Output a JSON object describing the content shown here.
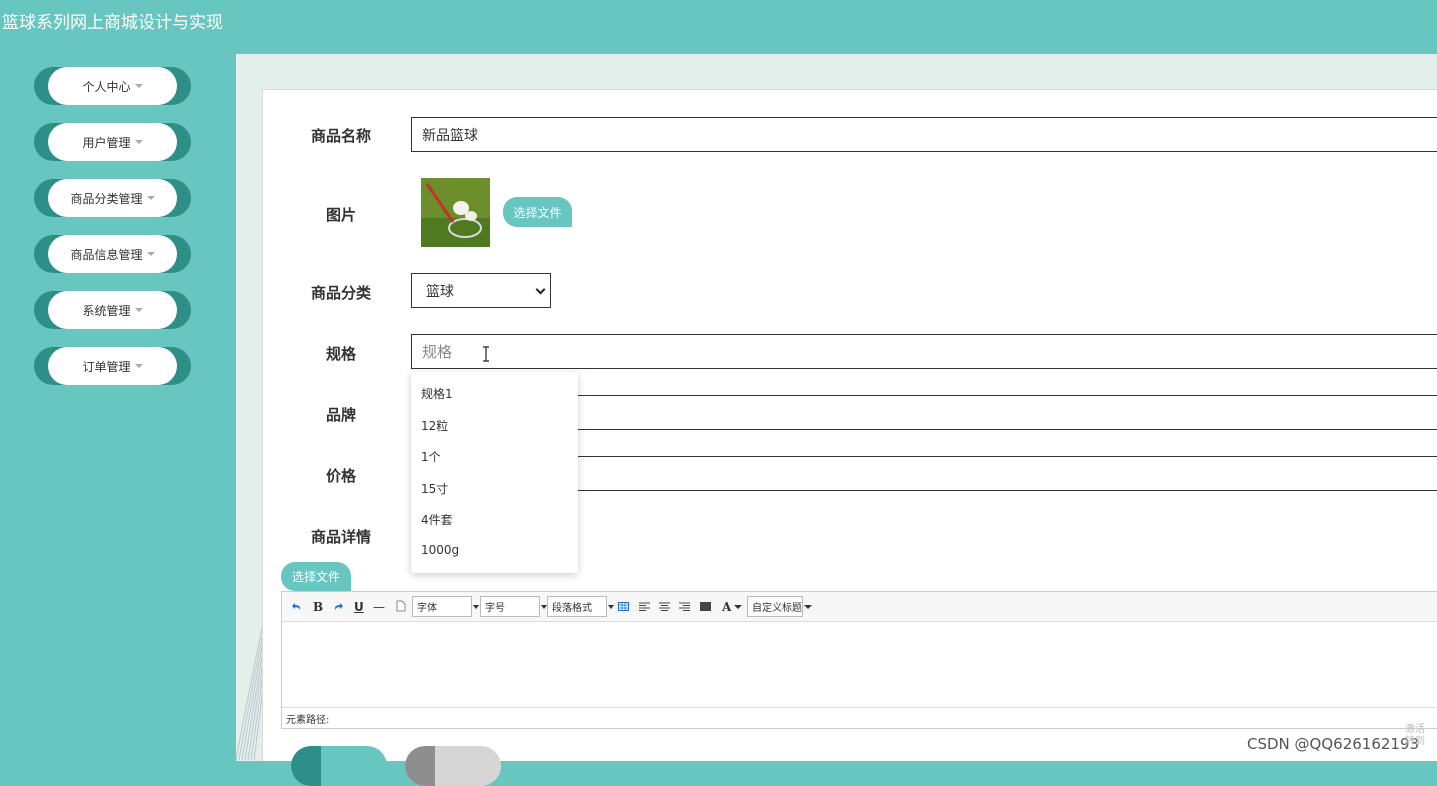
{
  "app": {
    "title": "篮球系列网上商城设计与实现"
  },
  "sidebar": {
    "items": [
      {
        "label": "个人中心"
      },
      {
        "label": "用户管理"
      },
      {
        "label": "商品分类管理"
      },
      {
        "label": "商品信息管理"
      },
      {
        "label": "系统管理"
      },
      {
        "label": "订单管理"
      }
    ]
  },
  "form": {
    "name_label": "商品名称",
    "name_value": "新品篮球",
    "image_label": "图片",
    "choose_file": "选择文件",
    "category_label": "商品分类",
    "category_value": "篮球",
    "spec_label": "规格",
    "spec_placeholder": "规格",
    "brand_label": "品牌",
    "price_label": "价格",
    "detail_label": "商品详情",
    "spec_suggestions": [
      "规格1",
      "12粒",
      "1个",
      "15寸",
      "4件套",
      "1000g"
    ]
  },
  "editor": {
    "choose_file": "选择文件",
    "toolbar": {
      "bold": "B",
      "underline": "U",
      "hr": "—",
      "font_family": "字体",
      "font_size": "字号",
      "paragraph": "段落格式",
      "font_color": "A",
      "custom_title": "自定义标题"
    },
    "path_label": "元素路径:"
  },
  "watermark": {
    "text": "CSDN @QQ626162193",
    "activate": "激活\n转到"
  },
  "colors": {
    "primary": "#68c6c1",
    "accent_dark": "#2e8f89",
    "panel": "#e4efec"
  }
}
